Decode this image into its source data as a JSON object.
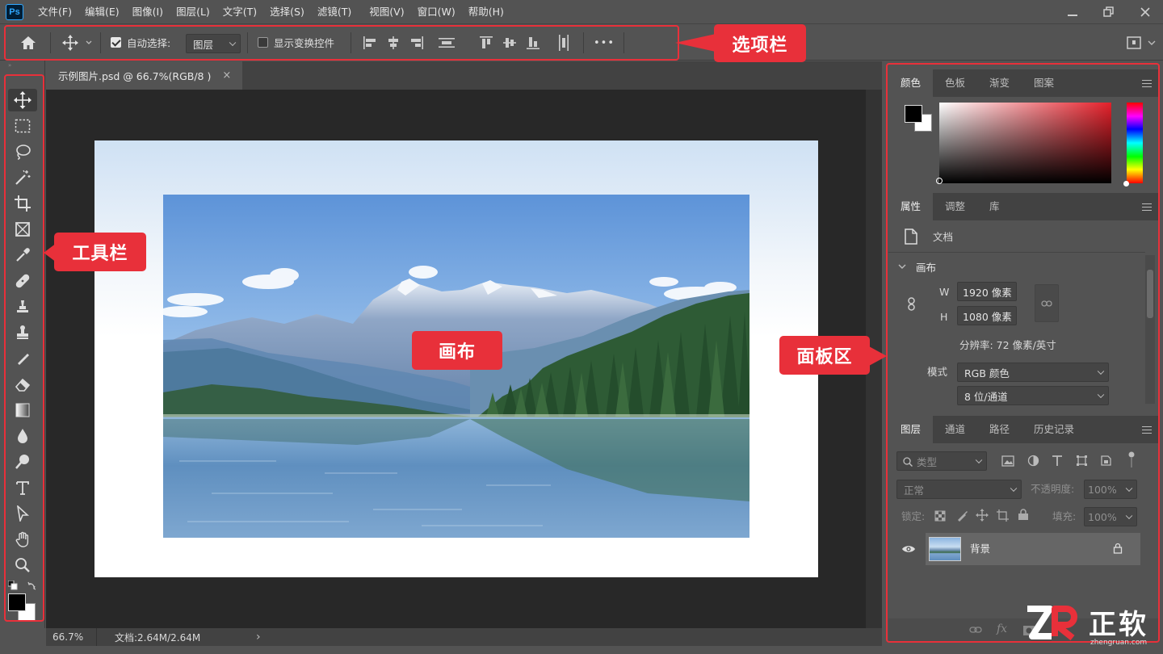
{
  "app": {
    "logo": "Ps"
  },
  "menu": [
    "文件(F)",
    "编辑(E)",
    "图像(I)",
    "图层(L)",
    "文字(T)",
    "选择(S)",
    "滤镜(T)",
    "视图(V)",
    "窗口(W)",
    "帮助(H)"
  ],
  "options": {
    "auto_select_label": "自动选择:",
    "auto_select_checked": true,
    "auto_select_target": "图层",
    "show_transform_label": "显示变换控件",
    "show_transform_checked": false,
    "more": "•••"
  },
  "document": {
    "tab_title": "示例图片.psd @ 66.7%(RGB/8 )",
    "tab_close": "×",
    "zoom": "66.7%",
    "doc_size": "文档:2.64M/2.64M",
    "status_arrow": "›"
  },
  "annotations": {
    "options_bar": "选项栏",
    "toolbar": "工具栏",
    "canvas": "画布",
    "panels": "面板区"
  },
  "color_panel": {
    "tabs": [
      "颜色",
      "色板",
      "渐变",
      "图案"
    ],
    "active_tab": 0,
    "foreground": "#000000",
    "background": "#ffffff",
    "hue_color": "#e5202a"
  },
  "properties_panel": {
    "tabs": [
      "属性",
      "调整",
      "库"
    ],
    "active_tab": 0,
    "doc_label": "文档",
    "section": "画布",
    "w_label": "W",
    "w_value": "1920 像素",
    "h_label": "H",
    "h_value": "1080 像素",
    "resolution": "分辨率: 72 像素/英寸",
    "mode_label": "模式",
    "mode_value": "RGB 颜色",
    "depth_value": "8 位/通道"
  },
  "layers_panel": {
    "tabs": [
      "图层",
      "通道",
      "路径",
      "历史记录"
    ],
    "active_tab": 0,
    "filter_placeholder": "类型",
    "blend_mode": "正常",
    "opacity_label": "不透明度:",
    "opacity_value": "100%",
    "lock_label": "锁定:",
    "fill_label": "填充:",
    "fill_value": "100%",
    "layers": [
      {
        "name": "背景",
        "visible": true,
        "locked": true
      }
    ]
  },
  "watermark": {
    "text": "正软",
    "sub": "zhengruan.com"
  }
}
